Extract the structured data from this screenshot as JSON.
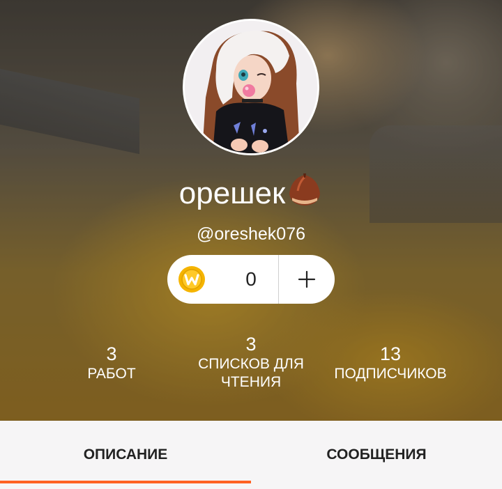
{
  "profile": {
    "display_name": "орешек",
    "name_emoji_icon": "chestnut-icon",
    "username": "@oreshek076",
    "avatar_icon": "anime-character-avatar"
  },
  "coins": {
    "icon": "wattpad-coin-icon",
    "count": "0",
    "add_icon": "plus-icon"
  },
  "stats": {
    "works": {
      "count": "3",
      "label": "РАБОТ"
    },
    "reading_lists": {
      "count": "3",
      "label_line1": "СПИСКОВ ДЛЯ",
      "label_line2": "ЧТЕНИЯ"
    },
    "followers": {
      "count": "13",
      "label": "ПОДПИСЧИКОВ"
    }
  },
  "tabs": {
    "about": "ОПИСАНИЕ",
    "messages": "СООБЩЕНИЯ",
    "active": "about"
  },
  "colors": {
    "accent": "#ff6122",
    "coin": "#f5b400"
  }
}
